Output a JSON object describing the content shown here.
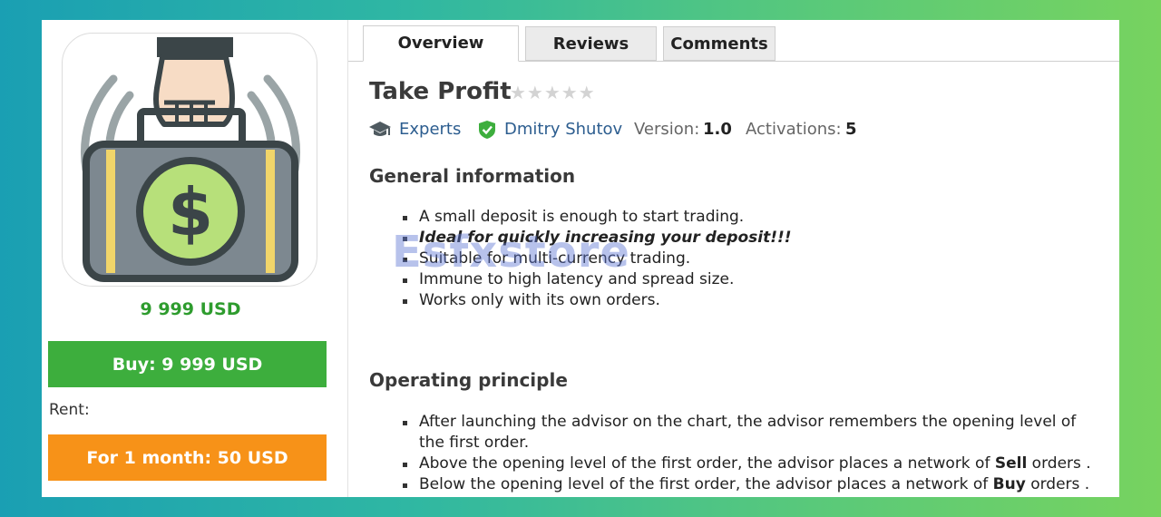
{
  "product": {
    "title": "Take Profit",
    "rating_stars": "★★★★★",
    "category": "Experts",
    "author": "Dmitry Shutov",
    "version_label": "Version:",
    "version_value": "1.0",
    "activations_label": "Activations:",
    "activations_value": "5"
  },
  "tabs": [
    {
      "label": "Overview",
      "active": true
    },
    {
      "label": "Reviews",
      "active": false
    },
    {
      "label": "Comments",
      "active": false
    }
  ],
  "sidebar": {
    "price": "9 999 USD",
    "buy_label": "Buy: 9 999 USD",
    "rent_label": "Rent:",
    "rent_option": "For 1 month: 50 USD"
  },
  "general": {
    "heading": "General information",
    "items": [
      "A small deposit is enough to start trading.",
      "Ideal for quickly increasing your deposit!!!",
      "Suitable for multi-currency trading.",
      "Immune to high latency and spread size.",
      "Works only with its own orders."
    ]
  },
  "operating": {
    "heading": "Operating principle",
    "item1_line1": "After launching the advisor on the chart, the advisor remembers the opening level of",
    "item1_line2": "the first order.",
    "item2_pre": "Above the opening level of the first order, the advisor places a network of ",
    "item2_bold": "Sell",
    "item2_post": " orders .",
    "item3_pre": "Below the opening level of the first order, the advisor places a network of ",
    "item3_bold": "Buy",
    "item3_post": " orders ."
  },
  "watermark": "Esfxstore",
  "colors": {
    "buy_button": "#3dae3d",
    "rent_button": "#f79218",
    "price_text": "#2e9c2e",
    "link": "#2c5d8f",
    "verified_badge": "#3dae3d"
  },
  "icons": {
    "category": "graduation-cap-icon",
    "author": "verified-shield-icon",
    "logo": "money-briefcase-icon"
  }
}
